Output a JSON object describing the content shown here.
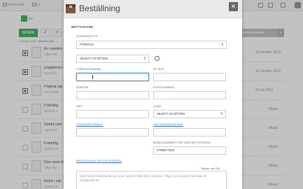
{
  "topbar": {
    "nav_katalog": "KATALOG",
    "nav_second": "K"
  },
  "toolbar": {
    "create_label": "SKAPA",
    "check_glyph": "✓",
    "selection_info_prefix": "0 klicker valda",
    "selection_info_link": "Markera alla",
    "update_label": "UPPDATERING"
  },
  "rows": [
    {
      "title": "En vandrin",
      "sub": "Viktor Ry",
      "date": "29 oktober 2012",
      "status": "",
      "checked": true
    },
    {
      "title": "Ungdomen",
      "sub": "Gustaf Fr",
      "date": "12 oktober 2012",
      "status": "",
      "checked": true
    },
    {
      "title": "Frigöra sig",
      "sub": "Axel Höpe",
      "date": "24 juli 2012",
      "status": "",
      "checked": true
    },
    {
      "title": "Frändlig",
      "sub": "Hjalmar S",
      "date": "",
      "status": "Utkast",
      "checked": false
    },
    {
      "title": "Delad rum",
      "sub": "Agnes va",
      "date": "",
      "status": "Utkast",
      "checked": false
    },
    {
      "title": "Frändlig",
      "sub": "Hjalmar S",
      "date": "",
      "status": "Utkast",
      "checked": false
    },
    {
      "title": "Den siste A",
      "sub": "Viktor Ry",
      "date": "",
      "status": "Utkast",
      "checked": false
    },
    {
      "title": "Kolet i väl",
      "sub": "Hjalmar S",
      "date": "",
      "status": "Utkast",
      "checked": false
    }
  ],
  "modal": {
    "title": "Beställning",
    "close_glyph": "✕",
    "section_mottagare": "MOTTAGARE",
    "leveranstyp_label": "LEVERANSTYP",
    "leveranstyp_value": "FÖRETAG",
    "option_select_value": "SELECT AN OPTION",
    "foretagsnamn_label": "FÖRETAGSNAMN",
    "foretagsnamn_value": "",
    "attest_label": "ATTEST",
    "adress_label": "ADRESS",
    "postnummer_label": "POSTNUMMER",
    "ort_label": "ORT",
    "land_label": "LAND",
    "land_value": "SELECT AN OPTION",
    "orderreferens_label": "ORDERREFERENS",
    "fakturareferens_label": "FAKTURAREFERENS",
    "mobil_label": "MOBILNUMMER FÖR SMS-NOTIFIERING",
    "mobil_value": "0709677519",
    "foljesedel_label": "MEDDELANDE PÅ FÖLJESEDEL",
    "counter_text": "Tecken: av 100",
    "message_placeholder": "Obs! Detta meddelande ses ej av varken Publit eller tryckeriet. Frågor om leverans hänvisas till info@publit.se"
  },
  "colors": {
    "accent_green": "#2ea44f",
    "link_blue": "#3a6fd8",
    "focus_blue": "#3a8fe0"
  }
}
